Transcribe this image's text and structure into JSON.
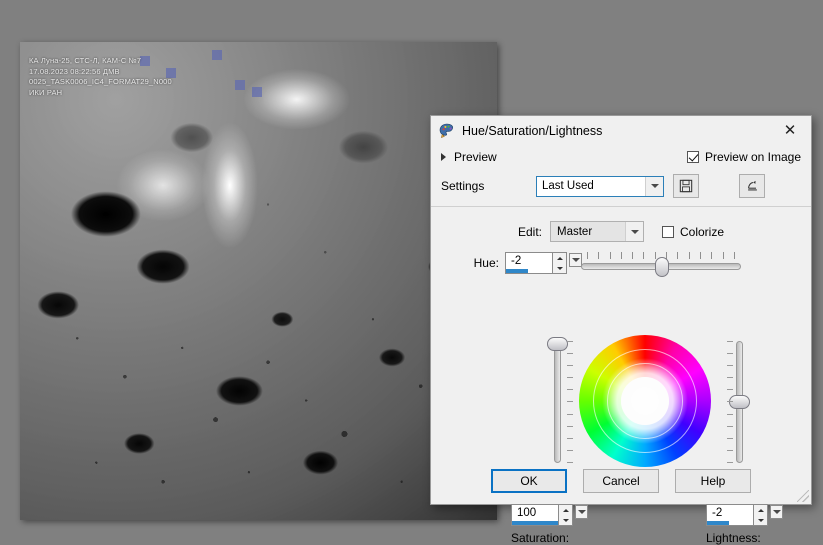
{
  "document_window": {
    "overlay_text": "КА Луна-25, СТС-Л, КАМ-С №7\n17.08.2023 08:22:56 ДМВ\n0025_TASK0006_IC4_FORMAT29_N000\nИКИ РАН",
    "image_description": "Grayscale lunar surface photograph with craters"
  },
  "dialog": {
    "title": "Hue/Saturation/Lightness",
    "title_icon": "palette-icon",
    "close_icon": "✕",
    "preview": {
      "label": "Preview",
      "caret_icon": "triangle-right-icon",
      "on_image_label": "Preview on Image",
      "on_image_checked": true
    },
    "settings": {
      "label": "Settings",
      "value": "Last Used",
      "save_icon": "floppy-disk-icon",
      "reset_icon": "reset-stamp-icon"
    },
    "edit": {
      "label": "Edit:",
      "value": "Master",
      "colorize_label": "Colorize",
      "colorize_checked": false
    },
    "hue": {
      "label": "Hue:",
      "value": "-2",
      "slider_percent": 46,
      "tick_count": 14
    },
    "saturation": {
      "label": "Saturation:",
      "value": "100",
      "slider_percent": 100,
      "fill_percent": 100
    },
    "lightness": {
      "label": "Lightness:",
      "value": "-2",
      "slider_percent": 50,
      "fill_percent": 48
    },
    "buttons": {
      "ok": "OK",
      "cancel": "Cancel",
      "help": "Help"
    }
  },
  "colors": {
    "accent": "#0a72c4",
    "spin_fill": "#2f87c9",
    "dialog_bg": "#f0f0f0",
    "desktop_bg": "#808080"
  }
}
